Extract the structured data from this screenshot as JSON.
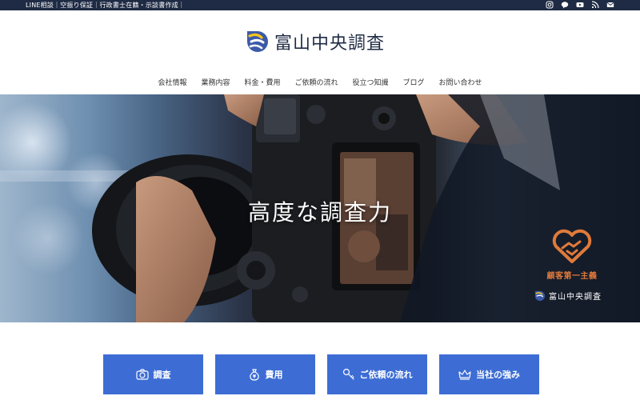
{
  "topbar": {
    "text": "LINE相談｜空振り保証｜行政書士在籍・示談書作成｜",
    "icons": [
      "instagram-icon",
      "line-icon",
      "youtube-icon",
      "rss-icon",
      "mail-icon"
    ]
  },
  "header": {
    "logo_text": "富山中央調査"
  },
  "nav": {
    "items": [
      "会社情報",
      "業務内容",
      "料金・費用",
      "ご依頼の流れ",
      "役立つ知識",
      "ブログ",
      "お問い合わせ"
    ]
  },
  "hero": {
    "title": "高度な調査力",
    "badge_text": "顧客第一主義",
    "badge_logo_text": "富山中央調査"
  },
  "features": [
    {
      "label": "調査",
      "icon": "camera-icon"
    },
    {
      "label": "費用",
      "icon": "money-bag-icon"
    },
    {
      "label": "ご依頼の流れ",
      "icon": "key-icon"
    },
    {
      "label": "当社の強み",
      "icon": "crown-icon"
    }
  ],
  "colors": {
    "topbar": "#1f2b44",
    "brand_navy": "#1f2b44",
    "brand_yellow": "#f5c518",
    "button_blue": "#3d6dd4",
    "badge_orange": "#e07a3a"
  }
}
